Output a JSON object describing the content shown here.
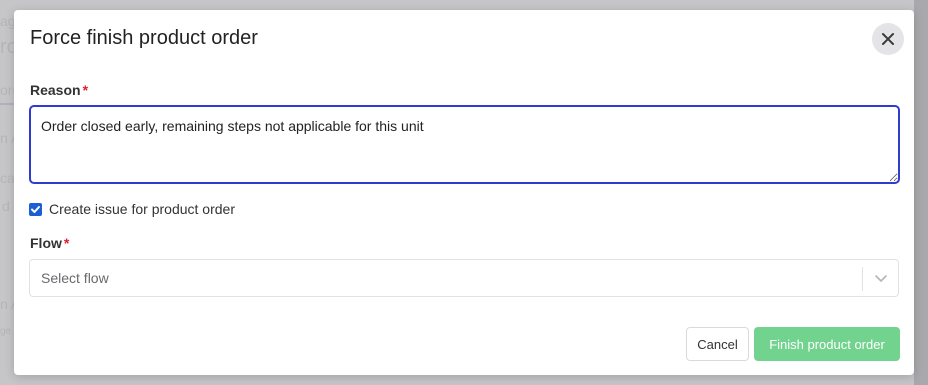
{
  "background": {
    "fragments": [
      "age",
      "ro",
      "ord",
      "n A",
      "ca",
      "d",
      "n A",
      "ge"
    ]
  },
  "modal": {
    "title": "Force finish product order",
    "close_icon": "close-icon",
    "reason": {
      "label": "Reason",
      "required_mark": "*",
      "value": "Order closed early, remaining steps not applicable for this unit"
    },
    "create_issue": {
      "checked": true,
      "label": "Create issue for product order"
    },
    "flow": {
      "label": "Flow",
      "required_mark": "*",
      "placeholder": "Select flow",
      "icon": "chevron-down-icon"
    },
    "buttons": {
      "cancel": "Cancel",
      "finish": "Finish product order"
    }
  },
  "colors": {
    "accent": "#2f3bd1",
    "checkbox": "#1a5fd6",
    "required": "#e0202b",
    "finish_button": "#72d38f"
  }
}
